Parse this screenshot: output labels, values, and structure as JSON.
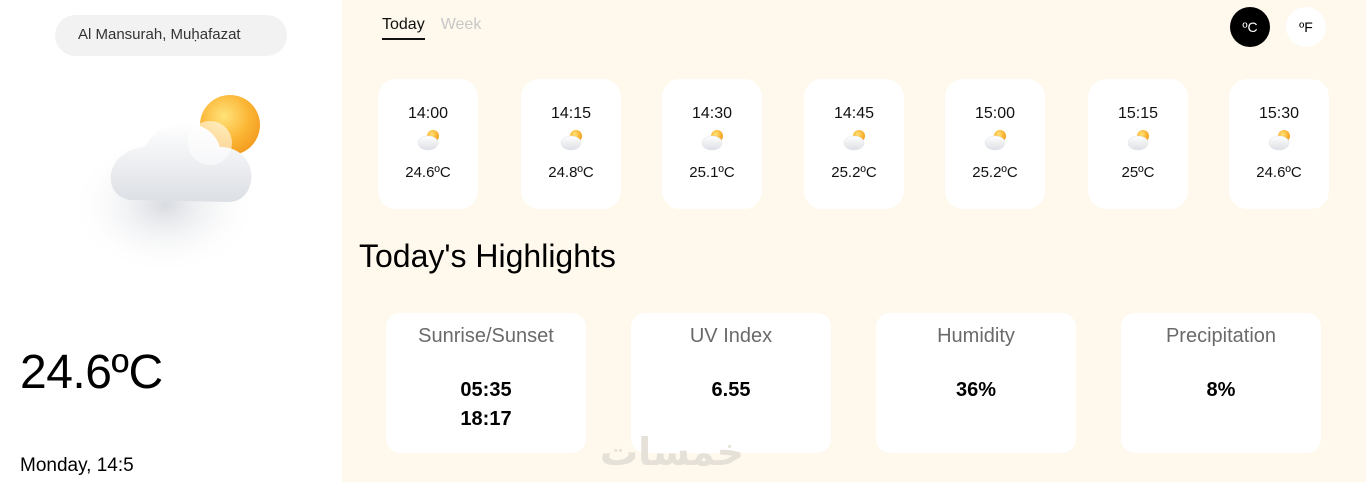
{
  "location": {
    "value": "Al Mansurah, Muḥafazat"
  },
  "current": {
    "temperature": "24.6ºC",
    "datetime": "Monday, 14:5",
    "icon": "partly-cloudy-day-icon"
  },
  "tabs": [
    {
      "label": "Today",
      "active": true
    },
    {
      "label": "Week",
      "active": false
    }
  ],
  "units": {
    "celsius": "ºC",
    "fahrenheit": "ºF",
    "selected": "celsius"
  },
  "hourly": [
    {
      "time": "14:00",
      "temp": "24.6ºC",
      "icon": "partly-cloudy-day-icon"
    },
    {
      "time": "14:15",
      "temp": "24.8ºC",
      "icon": "partly-cloudy-day-icon"
    },
    {
      "time": "14:30",
      "temp": "25.1ºC",
      "icon": "partly-cloudy-day-icon"
    },
    {
      "time": "14:45",
      "temp": "25.2ºC",
      "icon": "partly-cloudy-day-icon"
    },
    {
      "time": "15:00",
      "temp": "25.2ºC",
      "icon": "partly-cloudy-day-icon"
    },
    {
      "time": "15:15",
      "temp": "25ºC",
      "icon": "partly-cloudy-day-icon"
    },
    {
      "time": "15:30",
      "temp": "24.6ºC",
      "icon": "partly-cloudy-day-icon"
    }
  ],
  "highlights": {
    "title": "Today's Highlights",
    "sunrise_sunset": {
      "label": "Sunrise/Sunset",
      "sunrise": "05:35",
      "sunset": "18:17"
    },
    "uv_index": {
      "label": "UV Index",
      "value": "6.55"
    },
    "humidity": {
      "label": "Humidity",
      "value": "36%"
    },
    "precipitation": {
      "label": "Precipitation",
      "value": "8%"
    }
  },
  "watermark": {
    "text": "خمسات"
  },
  "colors": {
    "sidebar_bg": "#ffffff",
    "main_bg": "#fff8ec",
    "accent": "#000000",
    "sun": "#f7a928"
  }
}
